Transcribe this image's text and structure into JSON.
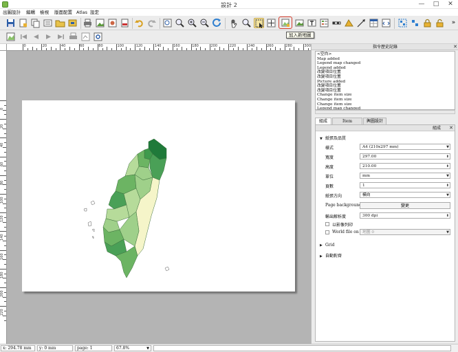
{
  "window": {
    "title": "設計 2",
    "controls": {
      "minimize": "—",
      "maximize": "□",
      "close": "✕"
    }
  },
  "menubar": {
    "items": [
      "出圖設計",
      "編輯",
      "檢視",
      "版面配置",
      "Atlas",
      "設定"
    ]
  },
  "toolbar": {
    "add_map_tooltip": "加入新地圖"
  },
  "ruler": {
    "h_labels": [
      "0",
      "20",
      "40",
      "60",
      "80",
      "100",
      "120",
      "140",
      "160",
      "180",
      "200",
      "220",
      "240",
      "260",
      "280",
      "300"
    ],
    "v_labels": [
      "0",
      "20",
      "40",
      "60",
      "80",
      "100",
      "120",
      "140",
      "160",
      "180",
      "200",
      "220"
    ]
  },
  "history_panel": {
    "title": "指令歷史記錄",
    "items": [
      "<空白>",
      "Map added",
      "Legend map changed",
      "Legend added",
      "改變項目位置",
      "改變項目位置",
      "Picture added",
      "改變項目位置",
      "改變項目位置",
      "Change item size",
      "Change item size",
      "Change item size",
      "Legend map changed",
      "Item deleted"
    ],
    "selected_index": 13
  },
  "tabs": [
    "組成",
    "Item properties",
    "輿圖設計"
  ],
  "props_panel": {
    "title": "組成",
    "section_paper": "紙張及品質",
    "rows": {
      "preset": {
        "label": "樣式",
        "value": "A4 (210x297 mm)"
      },
      "width": {
        "label": "寬度",
        "value": "297.00"
      },
      "height": {
        "label": "高度",
        "value": "210.00"
      },
      "units": {
        "label": "單位",
        "value": "mm"
      },
      "pages": {
        "label": "頁數",
        "value": "1"
      },
      "orientation": {
        "label": "紙張方向",
        "value": "橫向"
      },
      "background": {
        "label": "Page background",
        "button": "變更"
      },
      "resolution": {
        "label": "輸出解析度",
        "value": "300 dpi"
      }
    },
    "print_as_raster": "以影像列印",
    "world_file": {
      "label": "World file on",
      "value": "地圖 0"
    },
    "section_grid": "Grid",
    "section_snap": "自動對齊"
  },
  "statusbar": {
    "x": "x: 294.78 mm",
    "y": "y: 0 mm",
    "page": "page: 1",
    "zoom": "67.8%"
  },
  "colors": {
    "accent_highlight": "#d23a2a",
    "map_dark": "#1f7a3a",
    "map_mid": "#6cb463",
    "map_light": "#b6db9a",
    "map_pale": "#f5f5c9"
  }
}
